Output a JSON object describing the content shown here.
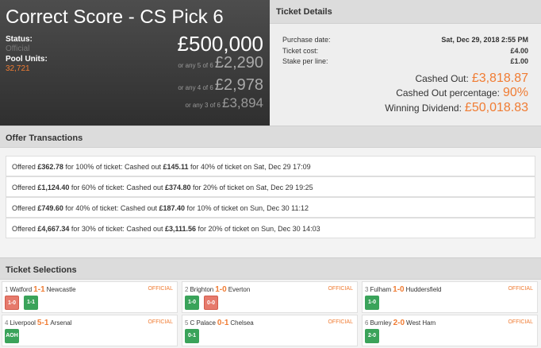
{
  "pool": {
    "title": "Correct Score - CS Pick 6",
    "status_label": "Status:",
    "status_value": "Official",
    "units_label": "Pool Units:",
    "units_value": "32,721",
    "main_prize": "£500,000",
    "tiers": [
      {
        "prefix": "or any 5 of 6",
        "amount": "£2,290"
      },
      {
        "prefix": "or any 4 of 6",
        "amount": "£2,978"
      },
      {
        "prefix": "or any 3 of 6",
        "amount": "£3,894"
      }
    ]
  },
  "ticket": {
    "heading": "Ticket Details",
    "rows": [
      {
        "label": "Purchase date:",
        "value": "Sat, Dec 29, 2018 2:55 PM"
      },
      {
        "label": "Ticket cost:",
        "value": "£4.00"
      },
      {
        "label": "Stake per line:",
        "value": "£1.00"
      }
    ],
    "big_rows": [
      {
        "label": "Cashed Out:",
        "value": "£3,818.87"
      },
      {
        "label": "Cashed Out percentage:",
        "value": "90%"
      },
      {
        "label": "Winning Dividend:",
        "value": "£50,018.83"
      }
    ]
  },
  "offers": {
    "heading": "Offer Transactions",
    "items": [
      {
        "pre": "Offered ",
        "amount": "£362.78",
        "mid": " for 100% of ticket: Cashed out ",
        "cashed": "£145.11",
        "post": " for 40% of ticket on Sat, Dec 29 17:09"
      },
      {
        "pre": "Offered ",
        "amount": "£1,124.40",
        "mid": " for 60% of ticket: Cashed out ",
        "cashed": "£374.80",
        "post": " for 20% of ticket on Sat, Dec 29 19:25"
      },
      {
        "pre": "Offered ",
        "amount": "£749.60",
        "mid": " for 40% of ticket: Cashed out ",
        "cashed": "£187.40",
        "post": " for 10% of ticket on Sun, Dec 30 11:12"
      },
      {
        "pre": "Offered ",
        "amount": "£4,667.34",
        "mid": " for 30% of ticket: Cashed out ",
        "cashed": "£3,111.56",
        "post": " for 20% of ticket on Sun, Dec 30 14:03"
      }
    ]
  },
  "selections": {
    "heading": "Ticket Selections",
    "official_label": "OFFICIAL",
    "matches": [
      {
        "num": "1",
        "home": "Watford",
        "score": "1-1",
        "away": "Newcastle",
        "picks": [
          {
            "label": "1-0",
            "color": "red"
          },
          {
            "label": "1-1",
            "color": "green"
          }
        ]
      },
      {
        "num": "2",
        "home": "Brighton",
        "score": "1-0",
        "away": "Everton",
        "picks": [
          {
            "label": "1-0",
            "color": "green"
          },
          {
            "label": "0-0",
            "color": "red"
          }
        ]
      },
      {
        "num": "3",
        "home": "Fulham",
        "score": "1-0",
        "away": "Huddersfield",
        "picks": [
          {
            "label": "1-0",
            "color": "green"
          }
        ]
      },
      {
        "num": "4",
        "home": "Liverpool",
        "score": "5-1",
        "away": "Arsenal",
        "picks": [
          {
            "label": "AOH",
            "color": "green"
          }
        ]
      },
      {
        "num": "5",
        "home": "C Palace",
        "score": "0-1",
        "away": "Chelsea",
        "picks": [
          {
            "label": "0-1",
            "color": "green"
          }
        ]
      },
      {
        "num": "6",
        "home": "Burnley",
        "score": "2-0",
        "away": "West Ham",
        "picks": [
          {
            "label": "2-0",
            "color": "green"
          }
        ]
      }
    ]
  }
}
